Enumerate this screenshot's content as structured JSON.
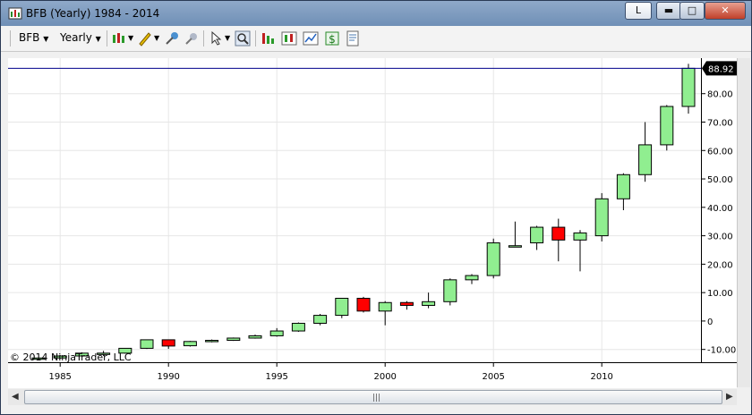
{
  "window": {
    "title": "BFB (Yearly)  1984 - 2014",
    "l_button": "L",
    "minimize_glyph": "▬",
    "maximize_glyph": "□",
    "close_glyph": "✕"
  },
  "toolbar": {
    "symbol": "BFB",
    "interval": "Yearly",
    "icons": [
      "bar-style-icon",
      "drawing-tool-icon",
      "magnet-icon",
      "pin-icon",
      "cursor-icon",
      "zoom-icon",
      "strategy-icon",
      "indicator-icon",
      "chart-icon",
      "money-icon",
      "properties-icon"
    ]
  },
  "chart_data": {
    "type": "candlestick",
    "title": "BFB (Yearly)  1984 - 2014",
    "x_tick_labels": [
      "1985",
      "1990",
      "1995",
      "2000",
      "2005",
      "2010"
    ],
    "y_tick_labels": [
      "-10.00",
      "0",
      "10.00",
      "20.00",
      "30.00",
      "40.00",
      "50.00",
      "60.00",
      "70.00",
      "80.00"
    ],
    "ylim": [
      -14.5,
      92.5
    ],
    "current_price_label": "88.92",
    "current_price": 88.92,
    "up_color": "#90ee90",
    "down_color": "#ff0000",
    "price_line_color": "#00008b",
    "grid": true,
    "candles": [
      {
        "year": 1984,
        "open": -13.0,
        "high": -12.8,
        "low": -13.2,
        "close": -13.0
      },
      {
        "year": 1985,
        "open": -13.0,
        "high": -12.0,
        "low": -13.3,
        "close": -12.3
      },
      {
        "year": 1986,
        "open": -12.3,
        "high": -11.0,
        "low": -12.5,
        "close": -11.3
      },
      {
        "year": 1987,
        "open": -11.5,
        "high": -10.5,
        "low": -12.3,
        "close": -11.3
      },
      {
        "year": 1988,
        "open": -11.3,
        "high": -9.5,
        "low": -11.5,
        "close": -9.6
      },
      {
        "year": 1989,
        "open": -9.6,
        "high": -6.5,
        "low": -9.8,
        "close": -6.6
      },
      {
        "year": 1990,
        "open": -6.6,
        "high": -6.5,
        "low": -9.8,
        "close": -8.8
      },
      {
        "year": 1991,
        "open": -8.7,
        "high": -7.0,
        "low": -9.0,
        "close": -7.2
      },
      {
        "year": 1992,
        "open": -7.2,
        "high": -6.5,
        "low": -7.5,
        "close": -6.8
      },
      {
        "year": 1993,
        "open": -6.8,
        "high": -5.8,
        "low": -7.0,
        "close": -6.0
      },
      {
        "year": 1994,
        "open": -6.0,
        "high": -4.8,
        "low": -6.2,
        "close": -5.2
      },
      {
        "year": 1995,
        "open": -5.2,
        "high": -2.5,
        "low": -5.5,
        "close": -3.5
      },
      {
        "year": 1996,
        "open": -3.5,
        "high": -0.5,
        "low": -3.8,
        "close": -0.8
      },
      {
        "year": 1997,
        "open": -0.8,
        "high": 2.5,
        "low": -1.5,
        "close": 2.0
      },
      {
        "year": 1998,
        "open": 2.0,
        "high": 8.0,
        "low": 1.0,
        "close": 8.0
      },
      {
        "year": 1999,
        "open": 8.0,
        "high": 8.5,
        "low": 3.0,
        "close": 3.5
      },
      {
        "year": 2000,
        "open": 3.5,
        "high": 7.0,
        "low": -1.5,
        "close": 6.5
      },
      {
        "year": 2001,
        "open": 6.5,
        "high": 7.0,
        "low": 4.0,
        "close": 5.5
      },
      {
        "year": 2002,
        "open": 5.5,
        "high": 10.0,
        "low": 4.5,
        "close": 6.8
      },
      {
        "year": 2003,
        "open": 6.8,
        "high": 15.0,
        "low": 5.5,
        "close": 14.5
      },
      {
        "year": 2004,
        "open": 14.5,
        "high": 16.5,
        "low": 13.0,
        "close": 16.0
      },
      {
        "year": 2005,
        "open": 16.0,
        "high": 29.0,
        "low": 15.0,
        "close": 27.5
      },
      {
        "year": 2006,
        "open": 26.0,
        "high": 35.0,
        "low": 26.0,
        "close": 26.5
      },
      {
        "year": 2007,
        "open": 27.5,
        "high": 33.5,
        "low": 25.0,
        "close": 33.0
      },
      {
        "year": 2008,
        "open": 33.0,
        "high": 36.0,
        "low": 21.0,
        "close": 28.5
      },
      {
        "year": 2009,
        "open": 28.5,
        "high": 32.0,
        "low": 17.5,
        "close": 31.0
      },
      {
        "year": 2010,
        "open": 30.0,
        "high": 45.0,
        "low": 28.0,
        "close": 43.0
      },
      {
        "year": 2011,
        "open": 43.0,
        "high": 52.0,
        "low": 39.0,
        "close": 51.5
      },
      {
        "year": 2012,
        "open": 51.5,
        "high": 70.0,
        "low": 49.0,
        "close": 62.0
      },
      {
        "year": 2013,
        "open": 62.0,
        "high": 76.0,
        "low": 60.0,
        "close": 75.5
      },
      {
        "year": 2014,
        "open": 75.5,
        "high": 90.5,
        "low": 73.0,
        "close": 88.92
      }
    ]
  },
  "footer": {
    "copyright": "© 2014 NinjaTrader, LLC"
  }
}
